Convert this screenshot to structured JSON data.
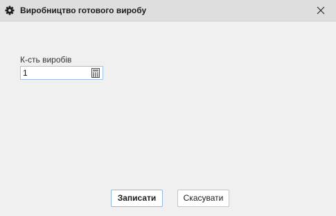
{
  "window": {
    "title": "Виробництво готового виробу"
  },
  "form": {
    "quantity_label": "К-сть виробів",
    "quantity_value": "1"
  },
  "footer": {
    "save_label": "Записати",
    "cancel_label": "Скасувати"
  },
  "icons": {
    "title": "gear-icon",
    "close": "close-icon",
    "calculator": "calculator-icon"
  },
  "colors": {
    "titlebar_bg": "#dedede",
    "body_bg": "#f0f0f0",
    "focus_border": "#9ec3e8"
  }
}
